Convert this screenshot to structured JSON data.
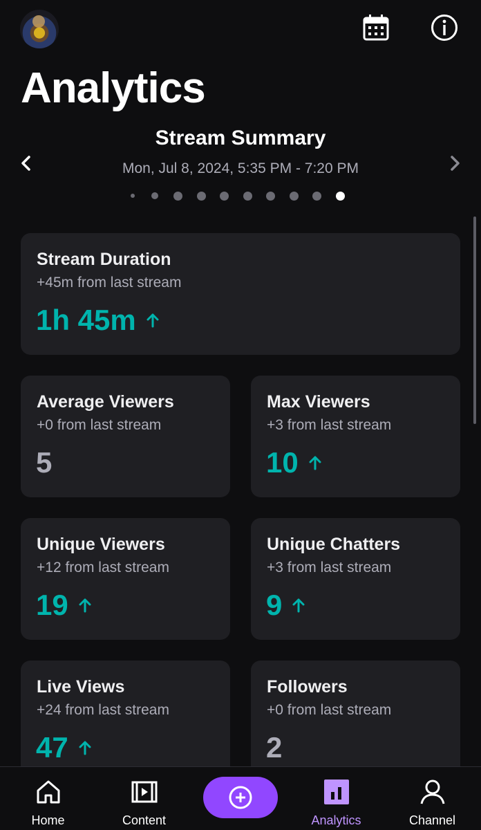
{
  "header": {
    "page_title": "Analytics",
    "icons": {
      "avatar": "user-avatar",
      "calendar": "calendar-icon",
      "info": "info-icon"
    }
  },
  "summary": {
    "title": "Stream Summary",
    "date_range": "Mon, Jul 8, 2024, 5:35 PM - 7:20 PM",
    "pager": {
      "total_dots": 10,
      "active_index": 9
    }
  },
  "cards": {
    "duration": {
      "title": "Stream Duration",
      "change": "+45m from last stream",
      "value": "1h 45m",
      "trend": "up"
    },
    "average_viewers": {
      "title": "Average Viewers",
      "change": "+0 from last stream",
      "value": "5",
      "trend": "flat"
    },
    "max_viewers": {
      "title": "Max Viewers",
      "change": "+3 from last stream",
      "value": "10",
      "trend": "up"
    },
    "unique_viewers": {
      "title": "Unique Viewers",
      "change": "+12 from last stream",
      "value": "19",
      "trend": "up"
    },
    "unique_chatters": {
      "title": "Unique Chatters",
      "change": "+3 from last stream",
      "value": "9",
      "trend": "up"
    },
    "live_views": {
      "title": "Live Views",
      "change": "+24 from last stream",
      "value": "47",
      "trend": "up"
    },
    "followers": {
      "title": "Followers",
      "change": "+0 from last stream",
      "value": "2",
      "trend": "flat"
    }
  },
  "nav": {
    "home": "Home",
    "content": "Content",
    "analytics": "Analytics",
    "channel": "Channel",
    "active": "analytics"
  },
  "colors": {
    "background": "#0e0e10",
    "card": "#1f1f23",
    "positive": "#00b4ad",
    "accent": "#9147ff",
    "active_nav": "#bf94ff",
    "muted": "#adadb8"
  }
}
